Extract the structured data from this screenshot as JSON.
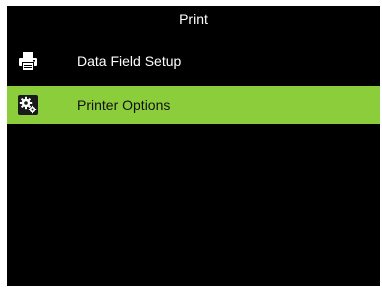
{
  "header": {
    "title": "Print"
  },
  "menu": {
    "items": [
      {
        "label": "Data Field Setup",
        "icon": "printer-icon",
        "selected": false
      },
      {
        "label": "Printer Options",
        "icon": "gear-icon",
        "selected": true
      }
    ]
  },
  "colors": {
    "screen_background": "#000000",
    "selected_row": "#8ccd3c",
    "text": "#ffffff"
  }
}
